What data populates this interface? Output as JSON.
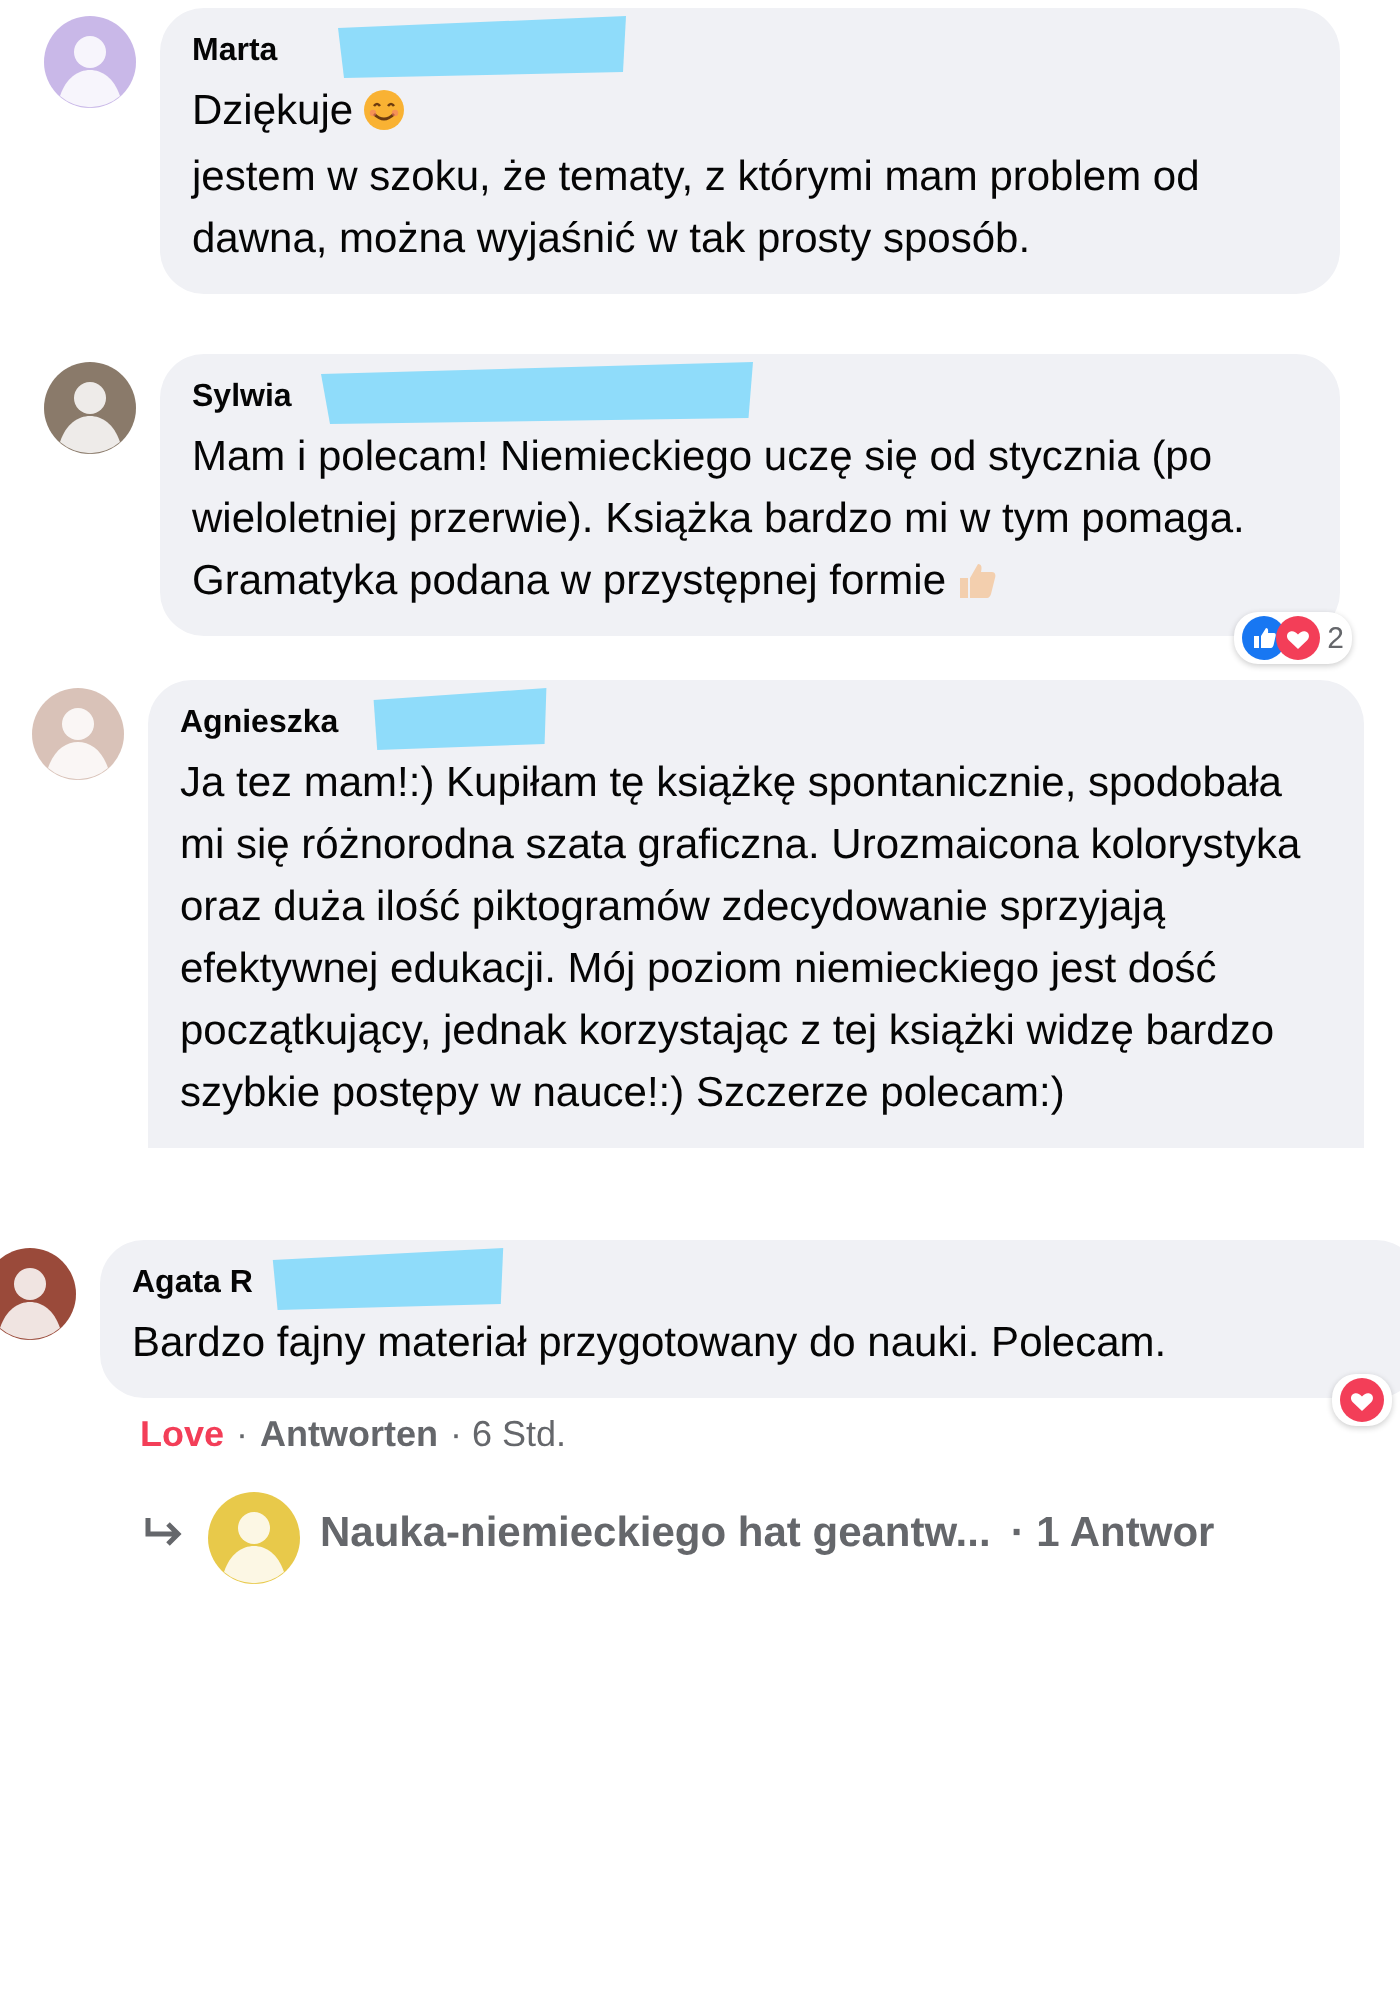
{
  "comments": [
    {
      "name": "Marta",
      "redacted": true,
      "lines": [
        {
          "text": "Dziękuje",
          "emoji": {
            "kind": "smile"
          }
        },
        {
          "text": "jestem w szoku, że tematy, z którymi mam problem od dawna, można wyjaśnić w tak prosty sposób."
        }
      ]
    },
    {
      "name": "Sylwia",
      "redacted": true,
      "lines": [
        {
          "text": "Mam i polecam! Niemieckiego uczę się od stycznia (po wieloletniej przerwie). Książka bardzo mi w tym pomaga. Gramatyka podana w przystępnej formie",
          "emoji": {
            "kind": "thumbs-up"
          }
        }
      ],
      "reactions": {
        "types": [
          {
            "kind": "like"
          },
          {
            "kind": "love"
          }
        ],
        "count": "2"
      }
    },
    {
      "name": "Agnieszka",
      "redacted": true,
      "lines": [
        {
          "text": "Ja tez mam!:) Kupiłam tę książkę spontanicznie, spodobała mi się różnorodna szata graficzna. Urozmaicona kolorystyka oraz duża ilość piktogramów zdecydowanie sprzyjają efektywnej edukacji. Mój poziom niemieckiego jest dość początkujący, jednak korzystając z tej książki widzę bardzo szybkie postępy w nauce!:) Szczerze polecam:)"
        }
      ],
      "cut": true
    },
    {
      "name": "Agata R",
      "redacted": true,
      "lines": [
        {
          "text": "Bardzo fajny materiał przygotowany do nauki. Polecam."
        }
      ],
      "reactions": {
        "types": [
          {
            "kind": "love"
          }
        ]
      },
      "actions": {
        "reaction": "Love",
        "separator": "·",
        "reply": "Antworten",
        "time": "· 6 Std."
      },
      "replies": {
        "author": "Nauka-niemieckiego hat geantw...",
        "count": "· 1 Antwor"
      }
    }
  ]
}
